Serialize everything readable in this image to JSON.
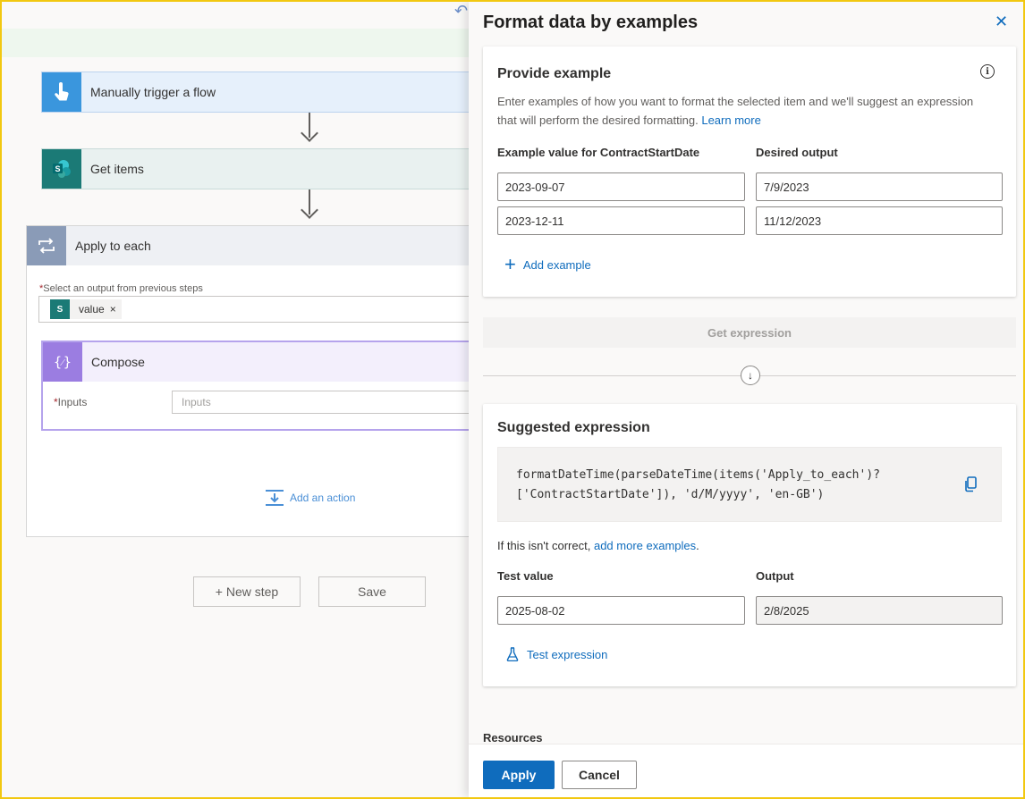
{
  "canvas": {
    "steps": [
      {
        "title": "Manually trigger a flow",
        "icon": "hand-touch-icon"
      },
      {
        "title": "Get items",
        "icon": "sharepoint-icon"
      }
    ],
    "apply_each": {
      "title": "Apply to each",
      "select_label": "Select an output from previous steps",
      "token": {
        "label": "value",
        "remove": "×",
        "icon_letter": "S"
      },
      "compose": {
        "title": "Compose",
        "inputs_label": "Inputs",
        "inputs_placeholder": "Inputs"
      },
      "add_action": "Add an action"
    },
    "new_step": "+ New step",
    "save": "Save",
    "required_mark": "*"
  },
  "panel": {
    "title": "Format data by examples",
    "provide": {
      "title": "Provide example",
      "description": "Enter examples of how you want to format the selected item and we'll suggest an expression that will perform the desired formatting.",
      "learn_more": "Learn more",
      "col_example": "Example value for ContractStartDate",
      "col_output": "Desired output",
      "rows": [
        {
          "example": "2023-09-07",
          "output": "7/9/2023"
        },
        {
          "example": "2023-12-11",
          "output": "11/12/2023"
        }
      ],
      "add_example": "Add example"
    },
    "get_expression": "Get expression",
    "suggested": {
      "title": "Suggested expression",
      "expression": "formatDateTime(parseDateTime(items('Apply_to_each')?['ContractStartDate']), 'd/M/yyyy', 'en-GB')",
      "not_correct": "If this isn't correct,",
      "add_more": "add more examples",
      "test_label": "Test value",
      "output_label": "Output",
      "test_value": "2025-08-02",
      "output_value": "2/8/2025",
      "test_expression": "Test expression"
    },
    "resources": "Resources",
    "apply": "Apply",
    "cancel": "Cancel"
  },
  "colors": {
    "accent": "#0f6cbd",
    "trigger": "#3a96dd",
    "sharepoint": "#1b7a76",
    "loop": "#8a9bb7",
    "compose": "#9b7de1"
  }
}
